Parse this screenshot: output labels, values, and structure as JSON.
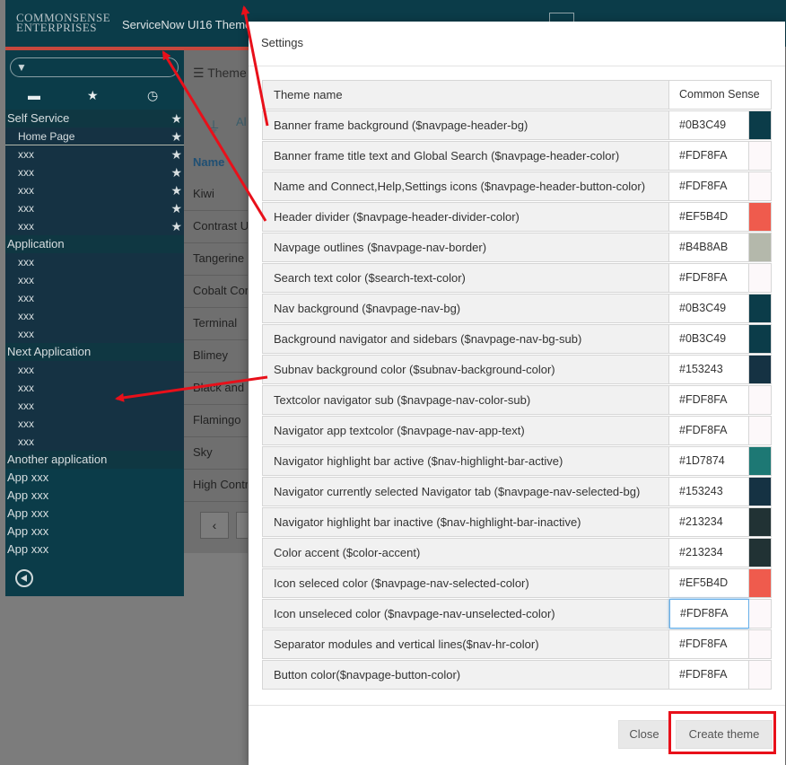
{
  "banner": {
    "logo_line1": "COMMONSENSE",
    "logo_line2": "ENTERPRISES",
    "title": "ServiceNow UI16 Theme"
  },
  "nav": {
    "tabs": [
      "folder-icon",
      "star-icon",
      "clock-icon"
    ],
    "sections": [
      {
        "title": "Self Service",
        "starred": true,
        "items": [
          {
            "label": "Home Page",
            "starred": true
          },
          {
            "label": "xxx",
            "starred": true
          },
          {
            "label": "xxx",
            "starred": true
          },
          {
            "label": "xxx",
            "starred": true
          },
          {
            "label": "xxx",
            "starred": true
          },
          {
            "label": "xxx",
            "starred": true
          }
        ]
      },
      {
        "title": "Application",
        "items": [
          {
            "label": "xxx"
          },
          {
            "label": "xxx"
          },
          {
            "label": "xxx"
          },
          {
            "label": "xxx"
          },
          {
            "label": "xxx"
          }
        ]
      },
      {
        "title": "Next Application",
        "items": [
          {
            "label": "xxx"
          },
          {
            "label": "xxx"
          },
          {
            "label": "xxx"
          },
          {
            "label": "xxx"
          },
          {
            "label": "xxx"
          }
        ]
      },
      {
        "title": "Another application",
        "items": []
      }
    ],
    "app_items": [
      "App xxx",
      "App xxx",
      "App xxx",
      "App xxx",
      "App xxx"
    ]
  },
  "content": {
    "header": "Theme",
    "filter_text": "Al",
    "column_name": "Name",
    "items": [
      "Kiwi",
      "Contrast UI",
      "Tangerine",
      "Cobalt Con",
      "Terminal",
      "Blimey",
      "Black and",
      "Flamingo",
      "Sky",
      "High Contr"
    ]
  },
  "modal": {
    "title": "Settings",
    "theme_name_label": "Theme name",
    "theme_name_value": "Common Sense",
    "rows": [
      {
        "label": "Banner frame background ($navpage-header-bg)",
        "value": "#0B3C49",
        "swatch": "#0B3C49"
      },
      {
        "label": "Banner frame title text and Global Search ($navpage-header-color)",
        "value": "#FDF8FA",
        "swatch": "#FDF8FA"
      },
      {
        "label": "Name and Connect,Help,Settings icons ($navpage-header-button-color)",
        "value": "#FDF8FA",
        "swatch": "#FDF8FA"
      },
      {
        "label": "Header divider ($navpage-header-divider-color)",
        "value": "#EF5B4D",
        "swatch": "#EF5B4D"
      },
      {
        "label": "Navpage outlines ($navpage-nav-border)",
        "value": "#B4B8AB",
        "swatch": "#B4B8AB"
      },
      {
        "label": "Search text color ($search-text-color)",
        "value": "#FDF8FA",
        "swatch": "#FDF8FA"
      },
      {
        "label": "Nav background ($navpage-nav-bg)",
        "value": "#0B3C49",
        "swatch": "#0B3C49"
      },
      {
        "label": "Background navigator and sidebars ($navpage-nav-bg-sub)",
        "value": "#0B3C49",
        "swatch": "#0B3C49"
      },
      {
        "label": "Subnav background color ($subnav-background-color)",
        "value": "#153243",
        "swatch": "#153243"
      },
      {
        "label": "Textcolor navigator sub ($navpage-nav-color-sub)",
        "value": "#FDF8FA",
        "swatch": "#FDF8FA"
      },
      {
        "label": "Navigator app textcolor ($navpage-nav-app-text)",
        "value": "#FDF8FA",
        "swatch": "#FDF8FA"
      },
      {
        "label": "Navigator highlight bar active ($nav-highlight-bar-active)",
        "value": "#1D7874",
        "swatch": "#1D7874"
      },
      {
        "label": "Navigator currently selected Navigator tab ($navpage-nav-selected-bg)",
        "value": "#153243",
        "swatch": "#153243"
      },
      {
        "label": "Navigator highlight bar inactive ($nav-highlight-bar-inactive)",
        "value": "#213234",
        "swatch": "#213234"
      },
      {
        "label": "Color accent ($color-accent)",
        "value": "#213234",
        "swatch": "#213234"
      },
      {
        "label": "Icon seleced color ($navpage-nav-selected-color)",
        "value": "#EF5B4D",
        "swatch": "#EF5B4D"
      },
      {
        "label": "Icon unseleced color ($navpage-nav-unselected-color)",
        "value": "#FDF8FA",
        "swatch": "#FDF8FA",
        "focused": true
      },
      {
        "label": "Separator modules and vertical lines($nav-hr-color)",
        "value": "#FDF8FA",
        "swatch": "#FDF8FA"
      },
      {
        "label": "Button color($navpage-button-color)",
        "value": "#FDF8FA",
        "swatch": "#FDF8FA"
      }
    ],
    "close_label": "Close",
    "create_label": "Create theme"
  },
  "colors": {
    "annotation": "#e8101a",
    "banner_bg": "#0b3c49",
    "divider": "#c7473d",
    "subnav": "#153243"
  }
}
